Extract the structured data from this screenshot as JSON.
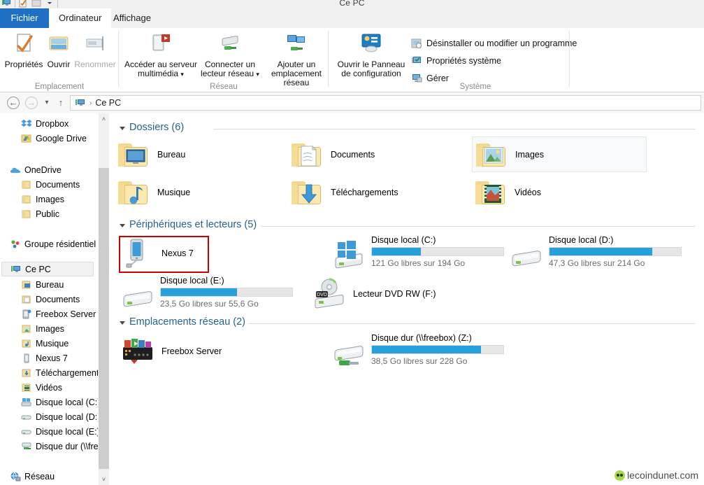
{
  "window": {
    "title": "Ce PC",
    "quick_access_icons": [
      "properties-icon",
      "new-folder-icon",
      "customize-dropdown-icon"
    ]
  },
  "tabs": [
    {
      "label": "Fichier",
      "state": "file-menu"
    },
    {
      "label": "Ordinateur",
      "state": "active"
    },
    {
      "label": "Affichage",
      "state": "normal"
    }
  ],
  "ribbon": {
    "groups": [
      {
        "name": "Emplacement",
        "label": "Emplacement",
        "buttons": [
          {
            "label": "Propriétés",
            "icon": "properties-icon",
            "disabled": false
          },
          {
            "label": "Ouvrir",
            "icon": "open-folder-icon",
            "disabled": false
          },
          {
            "label": "Renommer",
            "icon": "rename-icon",
            "disabled": true
          }
        ]
      },
      {
        "name": "Reseau",
        "label": "Réseau",
        "buttons": [
          {
            "label": "Accéder au serveur multimédia",
            "icon": "media-server-icon",
            "dropdown": true
          },
          {
            "label": "Connecter un lecteur réseau",
            "icon": "map-network-drive-icon",
            "dropdown": true
          },
          {
            "label": "Ajouter un emplacement réseau",
            "icon": "add-network-location-icon",
            "dropdown": false
          }
        ]
      },
      {
        "name": "Systeme",
        "label": "Système",
        "buttons": [
          {
            "label": "Ouvrir le Panneau de configuration",
            "icon": "control-panel-icon"
          }
        ],
        "small_buttons": [
          {
            "label": "Désinstaller ou modifier un programme",
            "icon": "uninstall-program-icon"
          },
          {
            "label": "Propriétés système",
            "icon": "system-properties-icon"
          },
          {
            "label": "Gérer",
            "icon": "manage-computer-icon"
          }
        ]
      }
    ]
  },
  "addressbar": {
    "back_label": "Précédent",
    "forward_label": "Suivant",
    "recent_label": "Emplacements récents",
    "up_label": "Remonter d'un niveau",
    "icon": "this-pc-icon",
    "breadcrumbs": [
      "Ce PC"
    ],
    "separator": "›"
  },
  "navpane": {
    "items": [
      {
        "label": "Dropbox",
        "icon": "dropbox-icon",
        "indent": 0,
        "selected": false
      },
      {
        "label": "Google Drive",
        "icon": "google-drive-icon",
        "indent": 0,
        "selected": false
      },
      {
        "label": "OneDrive",
        "icon": "onedrive-icon",
        "indent": 0,
        "selected": false
      },
      {
        "label": "Documents",
        "icon": "folder-icon",
        "indent": 1,
        "selected": false
      },
      {
        "label": "Images",
        "icon": "folder-icon",
        "indent": 1,
        "selected": false
      },
      {
        "label": "Public",
        "icon": "folder-icon",
        "indent": 1,
        "selected": false
      },
      {
        "label": "Groupe résidentiel",
        "icon": "homegroup-icon",
        "indent": 0,
        "selected": false
      },
      {
        "label": "Ce PC",
        "icon": "this-pc-icon",
        "indent": 0,
        "selected": true
      },
      {
        "label": "Bureau",
        "icon": "desktop-folder-icon",
        "indent": 1,
        "selected": false
      },
      {
        "label": "Documents",
        "icon": "documents-folder-icon",
        "indent": 1,
        "selected": false
      },
      {
        "label": "Freebox Server",
        "icon": "freebox-server-icon",
        "indent": 1,
        "selected": false
      },
      {
        "label": "Images",
        "icon": "pictures-folder-icon",
        "indent": 1,
        "selected": false
      },
      {
        "label": "Musique",
        "icon": "music-folder-icon",
        "indent": 1,
        "selected": false
      },
      {
        "label": "Nexus 7",
        "icon": "phone-icon",
        "indent": 1,
        "selected": false
      },
      {
        "label": "Téléchargements",
        "icon": "downloads-folder-icon",
        "indent": 1,
        "selected": false
      },
      {
        "label": "Vidéos",
        "icon": "videos-folder-icon",
        "indent": 1,
        "selected": false
      },
      {
        "label": "Disque local (C:)",
        "icon": "system-drive-icon",
        "indent": 1,
        "selected": false
      },
      {
        "label": "Disque local (D:)",
        "icon": "drive-icon",
        "indent": 1,
        "selected": false
      },
      {
        "label": "Disque local (E:)",
        "icon": "drive-icon",
        "indent": 1,
        "selected": false
      },
      {
        "label": "Disque dur (\\\\fre",
        "icon": "network-drive-icon",
        "indent": 1,
        "selected": false
      },
      {
        "label": "Réseau",
        "icon": "network-icon",
        "indent": 0,
        "selected": false
      }
    ],
    "scroll_up": "˄",
    "scroll_down": "˅"
  },
  "content": {
    "sections": [
      {
        "name": "dossiers",
        "title": "Dossiers (6)",
        "items": [
          {
            "label": "Bureau",
            "icon": "desktop-folder-icon",
            "hover": false
          },
          {
            "label": "Documents",
            "icon": "documents-folder-icon",
            "hover": false
          },
          {
            "label": "Images",
            "icon": "pictures-folder-icon",
            "hover": true
          },
          {
            "label": "Musique",
            "icon": "music-folder-icon",
            "hover": false
          },
          {
            "label": "Téléchargements",
            "icon": "downloads-folder-icon",
            "hover": false
          },
          {
            "label": "Vidéos",
            "icon": "videos-folder-icon",
            "hover": false
          }
        ]
      },
      {
        "name": "peripheriques",
        "title": "Périphériques et lecteurs (5)",
        "items": [
          {
            "label": "Nexus 7",
            "icon": "phone-icon",
            "type": "device",
            "highlighted": true
          },
          {
            "label": "Disque local (C:)",
            "icon": "system-drive-icon",
            "type": "drive",
            "free_text": "121 Go libres sur 194 Go",
            "used_percent": 37
          },
          {
            "label": "Disque local (D:)",
            "icon": "drive-icon",
            "type": "drive",
            "free_text": "47,3 Go libres sur 214 Go",
            "used_percent": 78
          },
          {
            "label": "Disque local (E:)",
            "icon": "drive-icon",
            "type": "drive",
            "free_text": "23,5 Go libres sur 55,6 Go",
            "used_percent": 58
          },
          {
            "label": "Lecteur DVD RW (F:)",
            "icon": "dvd-drive-icon",
            "type": "device"
          }
        ]
      },
      {
        "name": "reseau",
        "title": "Emplacements réseau (2)",
        "items": [
          {
            "label": "Freebox Server",
            "icon": "freebox-server-icon",
            "type": "device"
          },
          {
            "label": "Disque dur (\\\\freebox) (Z:)",
            "icon": "network-drive-icon",
            "type": "drive",
            "free_text": "38,5 Go libres sur 228 Go",
            "used_percent": 83
          }
        ]
      }
    ]
  },
  "annotation": {
    "target": "Nexus 7",
    "color": "#cc0000"
  },
  "watermark": {
    "text": "lecoindunet.com",
    "icon": "green-face-icon"
  },
  "colors": {
    "accent_blue": "#26a0da",
    "tab_file_blue": "#1f6fc4",
    "section_heading": "#25628f",
    "annotation_red": "#cc0000"
  }
}
